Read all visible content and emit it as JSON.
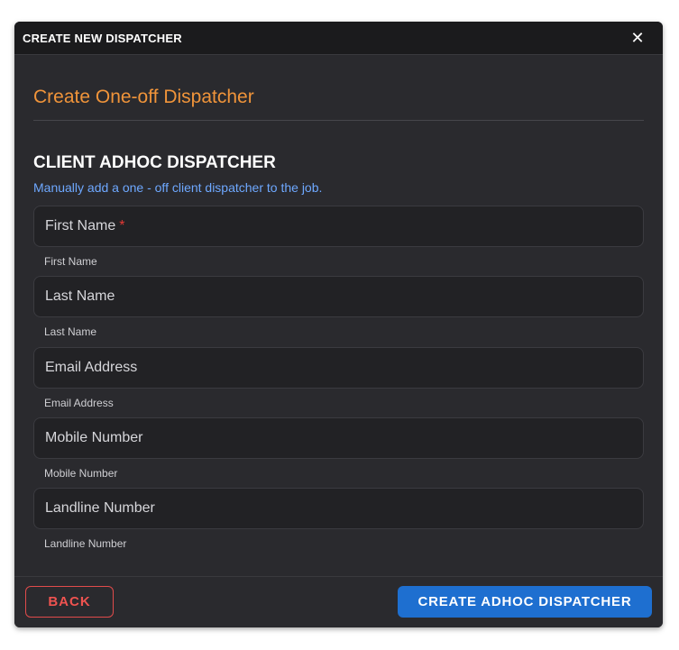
{
  "dialog": {
    "title": "CREATE NEW DISPATCHER",
    "close_icon": "close-icon",
    "subtitle": "Create One-off Dispatcher",
    "section_title": "CLIENT ADHOC DISPATCHER",
    "section_description": "Manually add a one - off client dispatcher to the job."
  },
  "form": {
    "fields": [
      {
        "label": "First Name",
        "required_marker": "*",
        "helper": "First Name",
        "value": ""
      },
      {
        "label": "Last Name",
        "helper": "Last Name",
        "value": ""
      },
      {
        "label": "Email Address",
        "helper": "Email Address",
        "value": ""
      },
      {
        "label": "Mobile Number",
        "helper": "Mobile Number",
        "value": ""
      },
      {
        "label": "Landline Number",
        "helper": "Landline Number",
        "value": ""
      }
    ]
  },
  "footer": {
    "back_label": "BACK",
    "create_label": "CREATE ADHOC DISPATCHER"
  },
  "colors": {
    "accent_orange": "#f0943a",
    "link_blue": "#6ea8ff",
    "primary_button": "#1e6fd0",
    "danger": "#ef5350"
  }
}
